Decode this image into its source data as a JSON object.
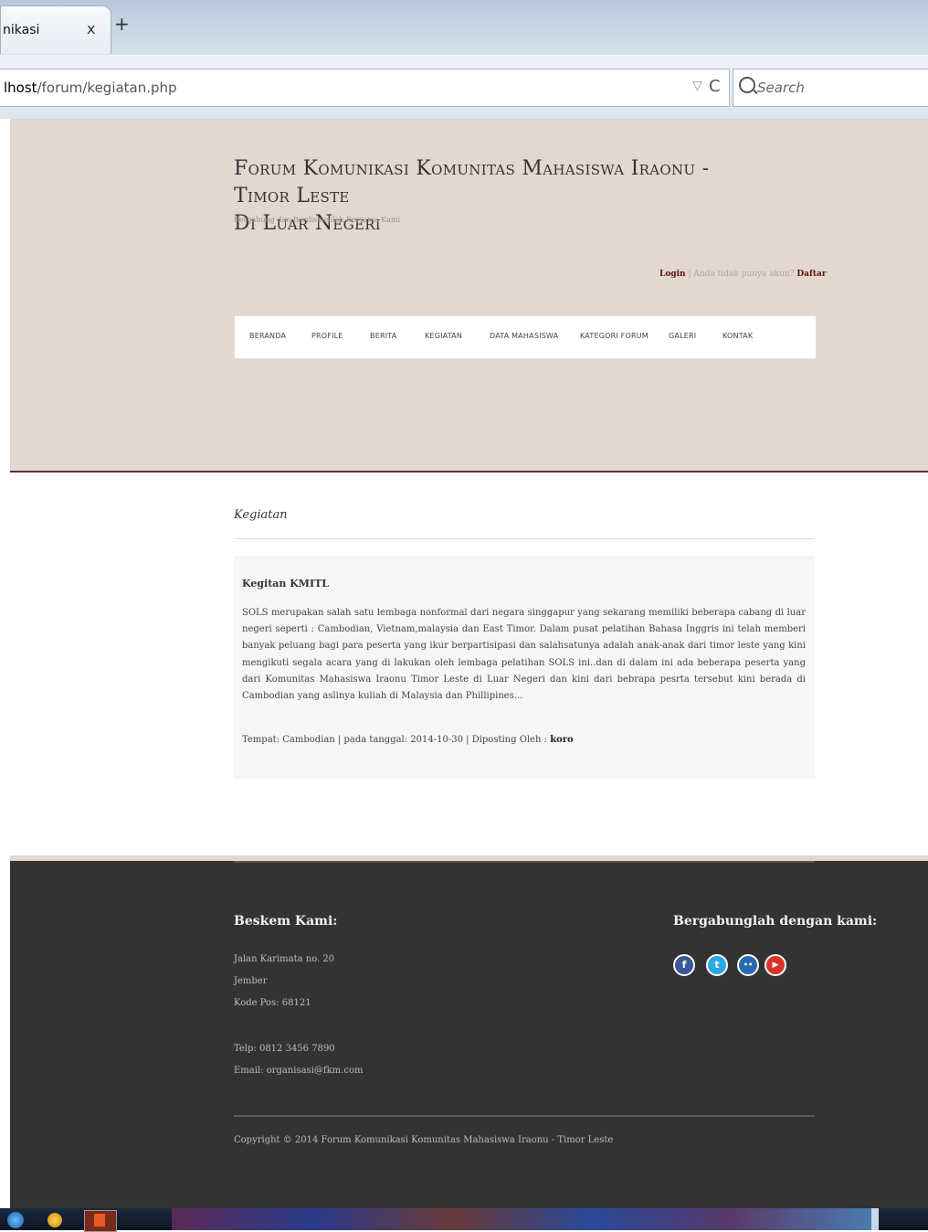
{
  "browser": {
    "tab_label": "nikasi",
    "tab_close": "x",
    "new_tab": "+",
    "url_host": "lhost",
    "url_path": "/forum/kegiatan.php",
    "url_dropdown": "▽",
    "url_reload": "C",
    "search_placeholder": "Search"
  },
  "header": {
    "title_line1": "Forum Komunikasi Komunitas Mahasiswa Iraonu - Timor Leste",
    "title_line2": "Di Luar Negeri",
    "subtitle": "Bergabung dan Berdiskusilah Bersama Kami",
    "login_label": "Login",
    "separator": " | ",
    "no_account_text": "Anda tidak punya akun? ",
    "register_label": "Daftar"
  },
  "menu": [
    "BERANDA",
    "PROFILE",
    "BERITA",
    "KEGIATAN",
    "DATA MAHASISWA",
    "KATEGORI FORUM",
    "GALERI",
    "KONTAK"
  ],
  "content": {
    "heading": "Kegiatan",
    "card": {
      "title": "Kegitan KMITL",
      "body": "SOLS merupakan salah satu lembaga nonformal dari negara singgapur yang sekarang memiliki beberapa cabang di luar negeri seperti : Cambodian, Vietnam,malaysia dan East Timor. Dalam pusat pelatihan Bahasa Inggris ini telah memberi banyak peluang bagi para peserta yang ikur berpartisipasi dan salahsatunya adalah anak-anak dari timor leste yang kini mengikuti segala acara yang di lakukan oleh lembaga pelatihan SOLS ini..dan di dalam ini ada beberapa peserta yang dari Komunitas Mahasiswa Iraonu Timor Leste di Luar Negeri dan kini dari bebrapa pesrta tersebut kini berada di Cambodian yang aslinya kuliah di Malaysia dan Phillipines...",
      "meta_prefix": "Tempat: Cambodian | pada tanggal: 2014-10-30 | Diposting Oleh : ",
      "author": "koro"
    }
  },
  "footer": {
    "address_heading": "Beskem Kami:",
    "address_line1": "Jalan Karimata no. 20",
    "address_line2": "Jember",
    "address_line3": "Kode Pos: 68121",
    "phone": "Telp: 0812 3456 7890",
    "email": "Email: organisasi@fkm.com",
    "social_heading": "Bergabunglah dengan kami:",
    "social": [
      {
        "icon": "facebook-icon",
        "glyph": "f",
        "color": "#3b5998"
      },
      {
        "icon": "twitter-icon",
        "glyph": "t",
        "color": "#29a9e1"
      },
      {
        "icon": "flickr-icon",
        "glyph": "••",
        "color": "#2a6ab0"
      },
      {
        "icon": "youtube-icon",
        "glyph": "▶",
        "color": "#d9342b"
      }
    ],
    "copyright": "Copyright © 2014 Forum Komunikasi Komunitas Mahasiswa Iraonu - Timor Leste"
  }
}
